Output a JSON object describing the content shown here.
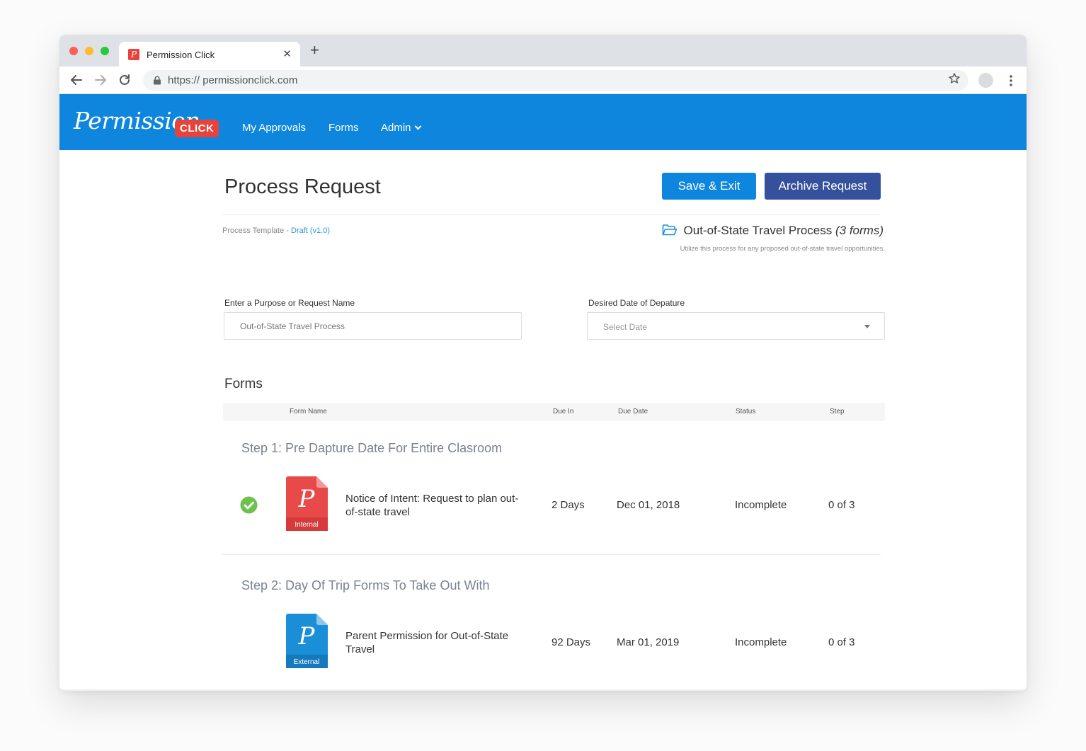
{
  "browser": {
    "tab_title": "Permission Click",
    "url": "https:// permissionclick.com"
  },
  "app": {
    "logo_word": "Permission",
    "logo_badge": "CLICK",
    "nav": [
      "My Approvals",
      "Forms",
      "Admin"
    ]
  },
  "page": {
    "title": "Process Request",
    "save_label": "Save & Exit",
    "archive_label": "Archive Request",
    "template_label": "Process Template - ",
    "template_link": "Draft (v1.0)",
    "process_name": "Out-of-State Travel Process",
    "process_count": "(3 forms)",
    "process_desc": "Utilize this process for any proposed out-of-state travel opportunities."
  },
  "fields": {
    "purpose_label": "Enter a Purpose or Request Name",
    "purpose_placeholder": "Out-of-State Travel Process",
    "date_label": "Desired Date of Depature",
    "date_placeholder": "Select Date"
  },
  "forms": {
    "title": "Forms",
    "columns": [
      "Form Name",
      "Due In",
      "Due Date",
      "Status",
      "Step"
    ],
    "steps": [
      {
        "title": "Step 1: Pre Dapture Date For Entire Clasroom",
        "rows": [
          {
            "name": "Notice of Intent: Request to plan out-of-state travel",
            "type": "Internal",
            "due_in": "2 Days",
            "due_date": "Dec 01, 2018",
            "status": "Incomplete",
            "step": "0 of 3",
            "checked": true,
            "icon_color": "#e84a4a"
          }
        ]
      },
      {
        "title": "Step 2: Day Of Trip Forms To Take Out With",
        "rows": [
          {
            "name": "Parent Permission for Out-of-State Travel",
            "type": "External",
            "due_in": "92 Days",
            "due_date": "Mar 01, 2019",
            "status": "Incomplete",
            "step": "0 of 3",
            "checked": false,
            "icon_color": "#1a8fd8"
          }
        ]
      }
    ]
  },
  "colors": {
    "brand_blue": "#0f86dd",
    "archive_blue": "#35519b",
    "brand_red": "#e8423a",
    "check_green": "#6cc24a"
  }
}
